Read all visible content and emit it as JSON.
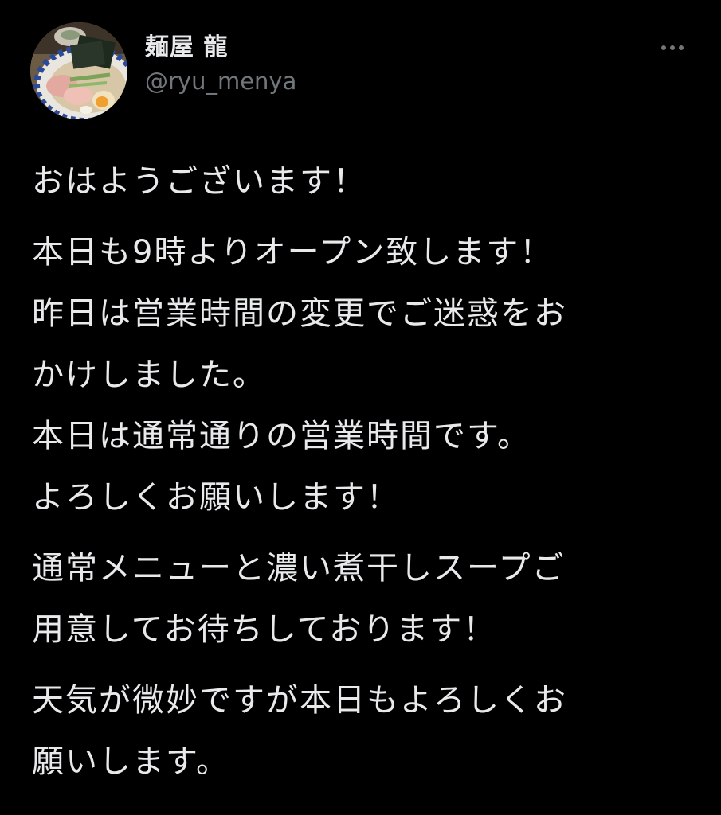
{
  "tweet": {
    "author": {
      "display_name": "麺屋 龍",
      "handle": "@ryu_menya",
      "avatar_icon": "ramen-bowl-avatar"
    },
    "more_icon": "more-horizontal-icon",
    "paragraphs": [
      {
        "lines": [
          "おはようございます！"
        ]
      },
      {
        "lines": [
          "本日も9時よりオープン致します！",
          "昨日は営業時間の変更でご迷惑をお",
          "かけしました。",
          "本日は通常通りの営業時間です。",
          "よろしくお願いします！"
        ]
      },
      {
        "lines": [
          "通常メニューと濃い煮干しスープご",
          "用意してお待ちしております！"
        ]
      },
      {
        "lines": [
          "天気が微妙ですが本日もよろしくお",
          "願いします。"
        ]
      }
    ]
  },
  "colors": {
    "background": "#000000",
    "text_primary": "#e7e9ea",
    "text_secondary": "#71767b"
  }
}
